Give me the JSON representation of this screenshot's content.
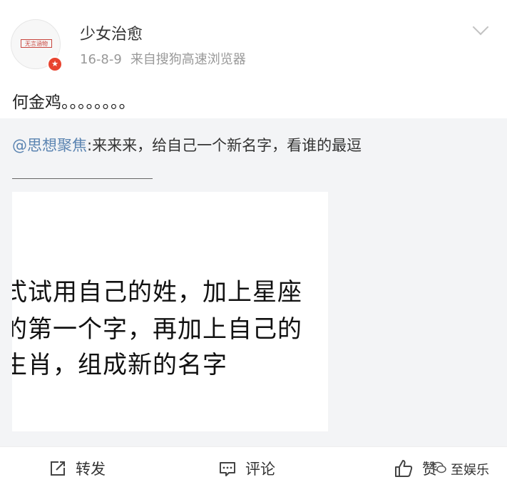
{
  "post": {
    "username": "少女治愈",
    "date": "16-8-9",
    "source": "来自搜狗高速浏览器",
    "avatar_text": "无言涵物",
    "avatar_badge": "★",
    "text": "何金鸡。。。。。。。。"
  },
  "repost": {
    "mention": "@思想聚焦",
    "text": ":来来来，给自己一个新名字，看谁的最逗",
    "image_lines": [
      "式试用自己的姓，加上星座",
      "的第一个字，再加上自己的",
      "生肖，组成新的名字"
    ]
  },
  "actions": {
    "repost_label": "转发",
    "comment_label": "评论",
    "like_label": "赞"
  },
  "watermark": "至娱乐",
  "colors": {
    "mention": "#5b84b1",
    "repost_bg": "#f3f4f6",
    "meta": "#999999",
    "badge": "#e8432f"
  }
}
